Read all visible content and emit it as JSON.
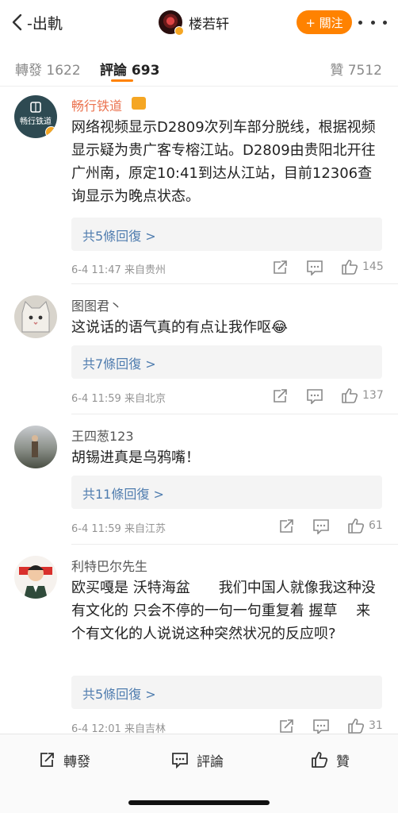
{
  "nav": {
    "back_label": "-出軌",
    "title": "楼若轩",
    "follow_label": "+ 關注"
  },
  "tabs": {
    "repost": "轉發 1622",
    "comment": "評論 693",
    "like": "贊 7512"
  },
  "comments": [
    {
      "name": "畅行铁道",
      "avatar_text": "畅行铁道",
      "text": "网络视频显示D2809次列车部分脱线，根据视频显示疑为贵广客专榕江站。D2809由贵阳北开往广州南，原定10:41到达从江站，目前12306查询显示为晚点状态。",
      "replies": "共5條回復 >",
      "meta": "6-4 11:47  来自贵州",
      "likes": "145"
    },
    {
      "name": "图图君丶",
      "text": "这说话的语气真的有点让我作呕😂",
      "replies": "共7條回復 >",
      "meta": "6-4 11:59  来自北京",
      "likes": "137"
    },
    {
      "name": "王四葱123",
      "text": "胡锡进真是乌鸦嘴！",
      "replies": "共11條回復 >",
      "meta": "6-4 11:59  来自江苏",
      "likes": "61"
    },
    {
      "name": "利特巴尔先生",
      "text": "欧买嘎是 沃特海盆　　我们中国人就像我这种没有文化的 只会不停的一句一句重复着 握草　 来个有文化的人说说这种突然状况的反应呗?",
      "replies": "共5條回復 >",
      "meta": "6-4 12:01  来自吉林",
      "likes": "31"
    }
  ],
  "bottom": {
    "repost": "轉發",
    "comment": "評論",
    "like": "贊"
  },
  "colors": {
    "accent": "#ff8200",
    "link": "#507daf",
    "verified_name": "#eb7350"
  }
}
